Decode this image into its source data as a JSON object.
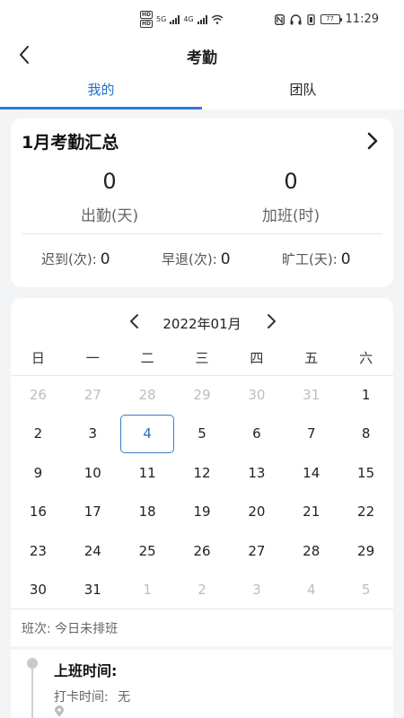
{
  "status_bar": {
    "hd1": "HD",
    "hd2": "HD",
    "net1": "5G",
    "net2": "4G",
    "battery": "77",
    "time": "11:29"
  },
  "header": {
    "title": "考勤"
  },
  "tabs": [
    {
      "label": "我的",
      "active": true
    },
    {
      "label": "团队",
      "active": false
    }
  ],
  "summary": {
    "title": "1月考勤汇总",
    "attendance_value": "0",
    "attendance_label": "出勤(天)",
    "overtime_value": "0",
    "overtime_label": "加班(时)",
    "late_label": "迟到(次):",
    "late_value": "0",
    "early_label": "早退(次):",
    "early_value": "0",
    "absent_label": "旷工(天):",
    "absent_value": "0"
  },
  "calendar": {
    "month": "2022年01月",
    "weekdays": [
      "日",
      "一",
      "二",
      "三",
      "四",
      "五",
      "六"
    ],
    "weeks": [
      [
        {
          "d": "26",
          "m": true
        },
        {
          "d": "27",
          "m": true
        },
        {
          "d": "28",
          "m": true
        },
        {
          "d": "29",
          "m": true
        },
        {
          "d": "30",
          "m": true
        },
        {
          "d": "31",
          "m": true
        },
        {
          "d": "1",
          "m": false
        }
      ],
      [
        {
          "d": "2",
          "m": false
        },
        {
          "d": "3",
          "m": false
        },
        {
          "d": "4",
          "m": false,
          "today": true
        },
        {
          "d": "5",
          "m": false
        },
        {
          "d": "6",
          "m": false
        },
        {
          "d": "7",
          "m": false
        },
        {
          "d": "8",
          "m": false
        }
      ],
      [
        {
          "d": "9",
          "m": false
        },
        {
          "d": "10",
          "m": false
        },
        {
          "d": "11",
          "m": false
        },
        {
          "d": "12",
          "m": false
        },
        {
          "d": "13",
          "m": false
        },
        {
          "d": "14",
          "m": false
        },
        {
          "d": "15",
          "m": false
        }
      ],
      [
        {
          "d": "16",
          "m": false
        },
        {
          "d": "17",
          "m": false
        },
        {
          "d": "18",
          "m": false
        },
        {
          "d": "19",
          "m": false
        },
        {
          "d": "20",
          "m": false
        },
        {
          "d": "21",
          "m": false
        },
        {
          "d": "22",
          "m": false
        }
      ],
      [
        {
          "d": "23",
          "m": false
        },
        {
          "d": "24",
          "m": false
        },
        {
          "d": "25",
          "m": false
        },
        {
          "d": "26",
          "m": false
        },
        {
          "d": "27",
          "m": false
        },
        {
          "d": "28",
          "m": false
        },
        {
          "d": "29",
          "m": false
        }
      ],
      [
        {
          "d": "30",
          "m": false
        },
        {
          "d": "31",
          "m": false
        },
        {
          "d": "1",
          "m": true
        },
        {
          "d": "2",
          "m": true
        },
        {
          "d": "3",
          "m": true
        },
        {
          "d": "4",
          "m": true
        },
        {
          "d": "5",
          "m": true
        }
      ]
    ],
    "shift_text": "班次:  今日未排班"
  },
  "checkin": {
    "title": "上班时间:",
    "punch_label": "打卡时间:",
    "punch_value": "无"
  },
  "colors": {
    "accent": "#2f7bd3",
    "background": "#f3f4f6",
    "card": "#ffffff",
    "muted_text": "#bdbdbd"
  }
}
